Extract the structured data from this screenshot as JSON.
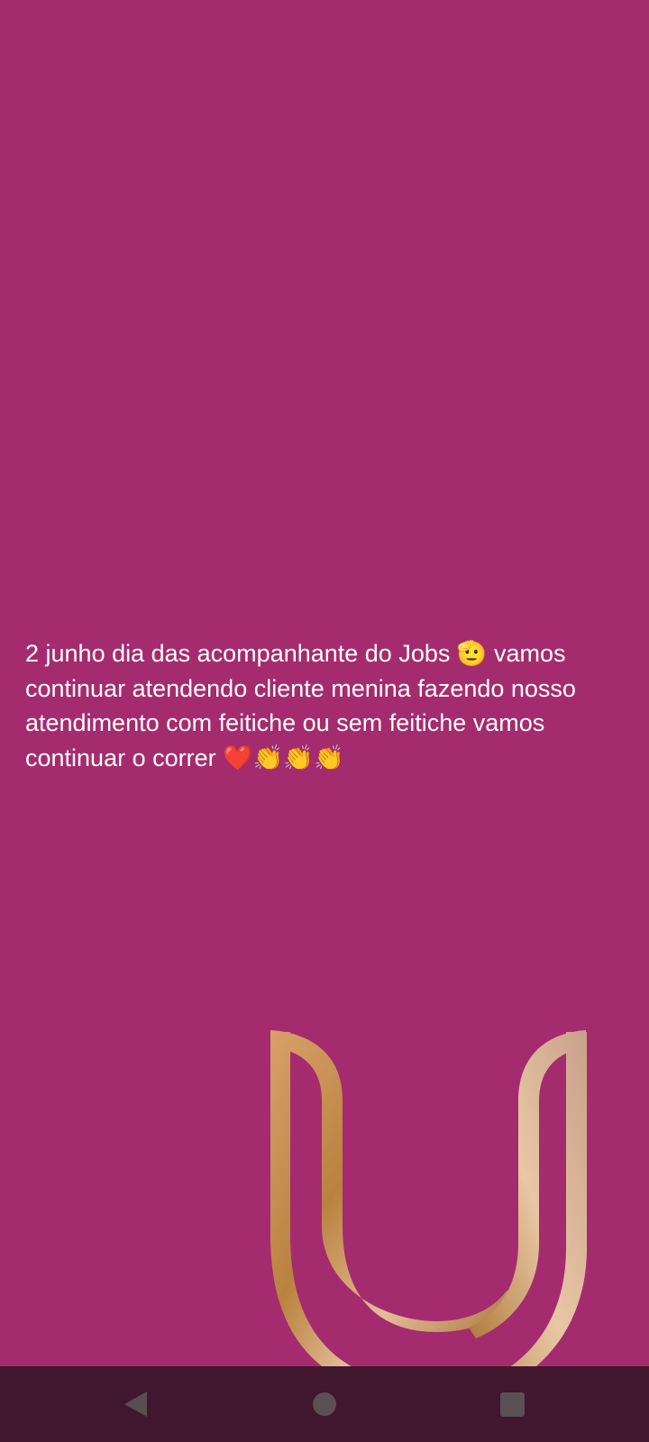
{
  "colors": {
    "background": "#a52b6f",
    "navbar": "#41162f",
    "logo_gold_light": "#e6c09a",
    "logo_gold_dark": "#b27838"
  },
  "post": {
    "text": "2 junho dia das acompanhante do Jobs 🫡 vamos continuar atendendo cliente menina fazendo nosso atendimento com feitiche ou sem feitiche vamos continuar o correr ❤️👏👏👏"
  },
  "logo": {
    "icon": "gold-u-logo-icon"
  },
  "navbar": {
    "back_icon": "back-triangle-icon",
    "home_icon": "home-circle-icon",
    "recents_icon": "recents-square-icon"
  }
}
